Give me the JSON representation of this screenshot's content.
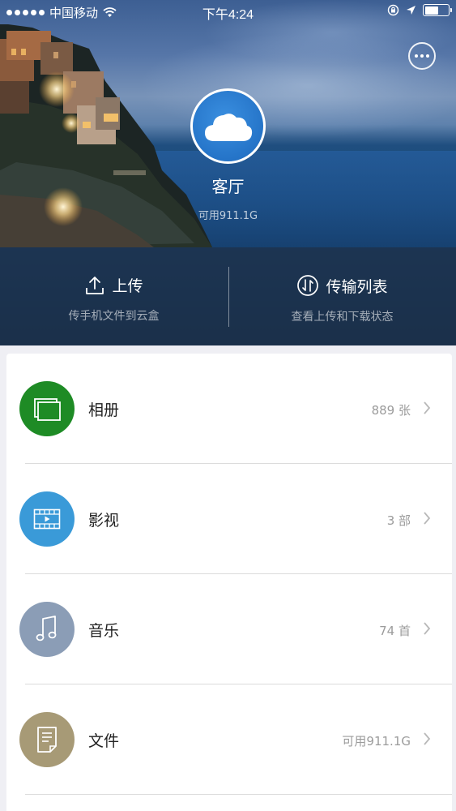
{
  "status_bar": {
    "carrier": "中国移动",
    "time": "下午4:24"
  },
  "device": {
    "name": "客厅",
    "storage": "可用911.1G"
  },
  "actions": [
    {
      "title": "上传",
      "subtitle": "传手机文件到云盒",
      "icon": "upload-icon"
    },
    {
      "title": "传输列表",
      "subtitle": "查看上传和下载状态",
      "icon": "transfer-icon"
    }
  ],
  "library": {
    "items": [
      {
        "label": "相册",
        "count": "889 张",
        "icon": "photo-album-icon",
        "color": "#1e8b25"
      },
      {
        "label": "影视",
        "count": "3 部",
        "icon": "film-icon",
        "color": "#3a9ad8"
      },
      {
        "label": "音乐",
        "count": "74 首",
        "icon": "music-note-icon",
        "color": "#8b9db6"
      },
      {
        "label": "文件",
        "count": "可用911.1G",
        "icon": "document-icon",
        "color": "#a79a76"
      }
    ]
  }
}
